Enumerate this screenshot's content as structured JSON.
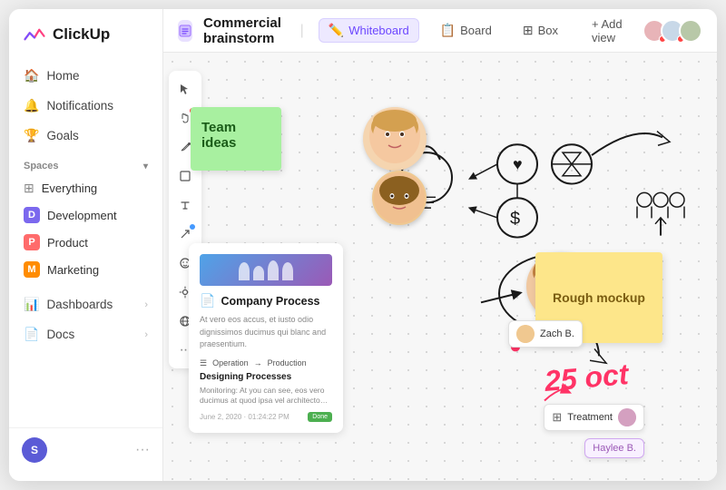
{
  "app": {
    "name": "ClickUp"
  },
  "sidebar": {
    "nav_items": [
      {
        "id": "home",
        "label": "Home",
        "icon": "🏠"
      },
      {
        "id": "notifications",
        "label": "Notifications",
        "icon": "🔔"
      },
      {
        "id": "goals",
        "label": "Goals",
        "icon": "🏆"
      }
    ],
    "spaces_title": "Spaces",
    "spaces": [
      {
        "id": "everything",
        "label": "Everything",
        "color": "transparent"
      },
      {
        "id": "development",
        "label": "Development",
        "color": "#7B68EE",
        "letter": "D"
      },
      {
        "id": "product",
        "label": "Product",
        "color": "#FF6B6B",
        "letter": "P"
      },
      {
        "id": "marketing",
        "label": "Marketing",
        "color": "#FF8C00",
        "letter": "M"
      }
    ],
    "bottom_items": [
      {
        "id": "dashboards",
        "label": "Dashboards"
      },
      {
        "id": "docs",
        "label": "Docs"
      }
    ],
    "footer": {
      "user_initial": "S",
      "user_name": ""
    }
  },
  "topbar": {
    "page_icon": "📋",
    "page_title": "Commercial brainstorm",
    "views": [
      {
        "id": "whiteboard",
        "label": "Whiteboard",
        "icon": "✏️",
        "active": true
      },
      {
        "id": "board",
        "label": "Board",
        "icon": "📋",
        "active": false
      },
      {
        "id": "box",
        "label": "Box",
        "icon": "⊞",
        "active": false
      }
    ],
    "add_view_label": "+ Add view"
  },
  "canvas": {
    "sticky_green_text": "Team ideas",
    "sticky_yellow_text": "Rough mockup",
    "card_title": "Company Process",
    "card_subheading": "Designing Processes",
    "card_operation": "Operation",
    "card_production": "Production",
    "date_label": "25 oct",
    "tag_zach": "Zach B.",
    "tag_haylee": "Haylee B.",
    "tag_treatment": "Treatment"
  }
}
